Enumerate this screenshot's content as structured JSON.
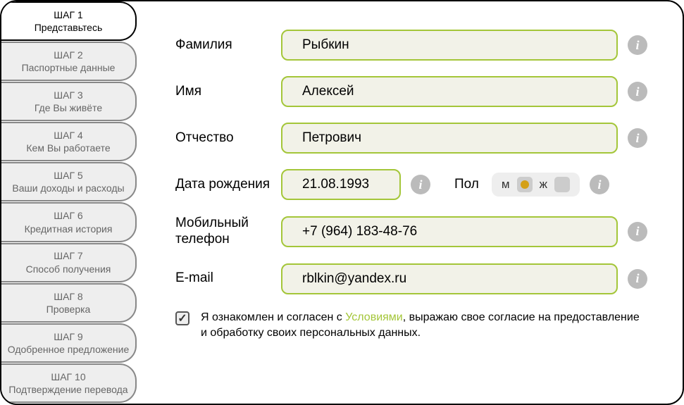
{
  "sidebar": {
    "steps": [
      {
        "num": "ШАГ 1",
        "title": "Представьтесь",
        "active": true
      },
      {
        "num": "ШАГ 2",
        "title": "Паспортные данные",
        "active": false
      },
      {
        "num": "ШАГ 3",
        "title": "Где Вы живёте",
        "active": false
      },
      {
        "num": "ШАГ 4",
        "title": "Кем Вы работаете",
        "active": false
      },
      {
        "num": "ШАГ 5",
        "title": "Ваши доходы и расходы",
        "active": false
      },
      {
        "num": "ШАГ 6",
        "title": "Кредитная история",
        "active": false
      },
      {
        "num": "ШАГ 7",
        "title": "Способ получения",
        "active": false
      },
      {
        "num": "ШАГ 8",
        "title": "Проверка",
        "active": false
      },
      {
        "num": "ШАГ 9",
        "title": "Одобренное предложение",
        "active": false
      },
      {
        "num": "ШАГ 10",
        "title": "Подтверждение перевода",
        "active": false
      }
    ]
  },
  "form": {
    "lastname_label": "Фамилия",
    "lastname_value": "Рыбкин",
    "firstname_label": "Имя",
    "firstname_value": "Алексей",
    "patronymic_label": "Отчество",
    "patronymic_value": "Петрович",
    "dob_label": "Дата рождения",
    "dob_value": "21.08.1993",
    "gender_label": "Пол",
    "gender_m": "м",
    "gender_f": "ж",
    "gender_selected": "m",
    "phone_label": "Мобильный телефон",
    "phone_value": "+7 (964) 183-48-76",
    "email_label": "E-mail",
    "email_value": "rblkin@yandex.ru",
    "consent_prefix": "Я ознакомлен и согласен с ",
    "consent_link": "Условиями",
    "consent_suffix": ", выражаю свое согласие на предоставление и обработку своих персональных данных.",
    "consent_checked": true
  },
  "info_glyph": "i"
}
